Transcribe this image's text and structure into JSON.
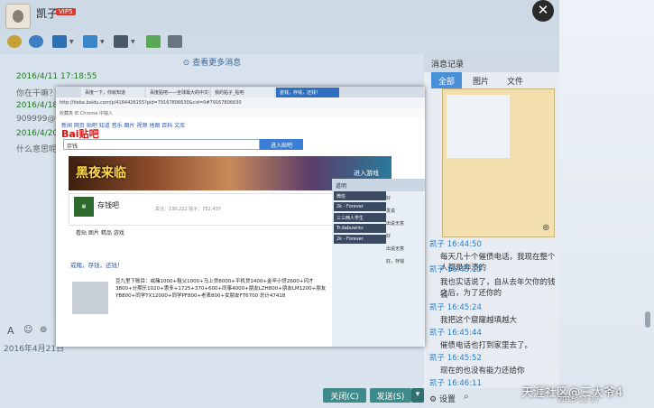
{
  "window": {
    "username": "凯子",
    "vip_badge": "VIP5"
  },
  "chat": {
    "more_messages": "查看更多消息",
    "messages": [
      {
        "time": "2016/4/11 17:18:55",
        "text": "你在干嘛？"
      },
      {
        "time": "2016/4/18 1",
        "text": "909999@9"
      },
      {
        "time": "2016/4/20 1",
        "text": "什么意思呢"
      }
    ],
    "date_partial": "2016年4月21日",
    "close_label": "关闭(C)",
    "send_label": "发送(S)"
  },
  "history": {
    "title": "消息记录",
    "tabs": [
      {
        "label": "全部"
      },
      {
        "label": "图片"
      },
      {
        "label": "文件"
      }
    ],
    "messages": [
      {
        "name": "凯子 16:44:50",
        "text": "每天几十个催债电话，我现在整个人都是奔溃的"
      },
      {
        "name": "凯子 16:45:15",
        "text": "我也实话说了，自从去年欠你的钱之后，为了还你的"
      },
      {
        "name": "",
        "text": "钱"
      },
      {
        "name": "凯子 16:45:24",
        "text": "我把这个窟窿越填越大"
      },
      {
        "name": "凯子 16:45:44",
        "text": "催债电话也打到家里去了。"
      },
      {
        "name": "凯子 16:45:52",
        "text": "现在的也没有能力还给你"
      },
      {
        "name": "凯子 16:46:11",
        "text": ""
      }
    ],
    "settings_label": "设置",
    "watermark": "天涯社区@三大爷4",
    "watermark_date": "2015-11-17"
  },
  "screenshot": {
    "tabs": [
      "百度一下，你就知道",
      "百度贴吧——全球最大的中文社区",
      "我的贴子_贴吧",
      "首钱，存钱，还钱！"
    ],
    "url": "http://tieba.baidu.com/p/4164426155?pid=79167806630&cid=0#79167806630",
    "favorites": "收藏夹   IE Chrome 中输入",
    "nav_links": "新闻  网页  贴吧  知道  音乐  图片  视频  地图  百科  文库",
    "logo": "Bai贴吧",
    "search_value": "存钱",
    "search_button": "进入贴吧",
    "banner_title": "黑夜来临",
    "banner_cta": "进入游戏",
    "forum_name": "存钱吧",
    "forum_stats": "关注：130,222  贴子：752,437",
    "forum_tabs": "看贴    图片    精品    游戏",
    "post_title": "戒赌，存钱，还钱！",
    "post_body": "豆九里下账目：戒赌1000+租父1000+马上贷8000+平机贷1400+金辛小贷2600+闪才3800+分期乐1020+惠多+1725+370+600+同事4000+朋友LZH800+朋友LM1200+朋友YB800+同学TX12000+同学PF800+老表800+女朋友FT6700 总计47418",
    "side_title": "道明",
    "side_items": [
      "微信",
      "2k - Forever",
      "三三两人学生",
      "Tr.dabuwrks",
      "2k - Forever"
    ],
    "side_replies": [
      "好",
      "发说",
      "出说无意",
      "好",
      "出说无意",
      "好，存钱"
    ],
    "ad_label": "进入游戏"
  }
}
